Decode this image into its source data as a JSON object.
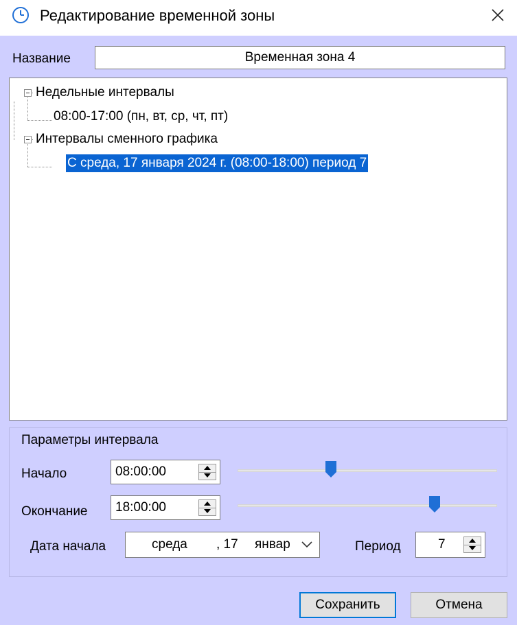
{
  "window": {
    "title": "Редактирование временной зоны",
    "icon": "clock-icon",
    "close_icon": "close-icon"
  },
  "name_field": {
    "label": "Название",
    "value": "Временная зона 4"
  },
  "tree": {
    "nodes": [
      {
        "label": "Недельные интервалы",
        "expanded": true,
        "children": [
          "08:00-17:00 (пн, вт, ср, чт, пт)"
        ]
      },
      {
        "label": "Интервалы сменного графика",
        "expanded": true,
        "children": [
          "С среда, 17 января 2024 г. (08:00-18:00) период 7"
        ],
        "selected_child": 0
      }
    ]
  },
  "interval_params": {
    "group_label": "Параметры интервала",
    "start": {
      "label": "Начало",
      "value": "08:00:00",
      "slider_fraction": 0.36
    },
    "end": {
      "label": "Окончание",
      "value": "18:00:00",
      "slider_fraction": 0.76
    },
    "start_date": {
      "label": "Дата начала",
      "weekday": "среда",
      "day": ", 17",
      "month": "январ"
    },
    "period": {
      "label": "Период",
      "value": "7"
    }
  },
  "buttons": {
    "save": "Сохранить",
    "cancel": "Отмена"
  },
  "colors": {
    "dialog_bg": "#cfcfff",
    "selection": "#0a64d2",
    "slider_thumb": "#1f6fd6",
    "default_button_border": "#0078d7"
  }
}
